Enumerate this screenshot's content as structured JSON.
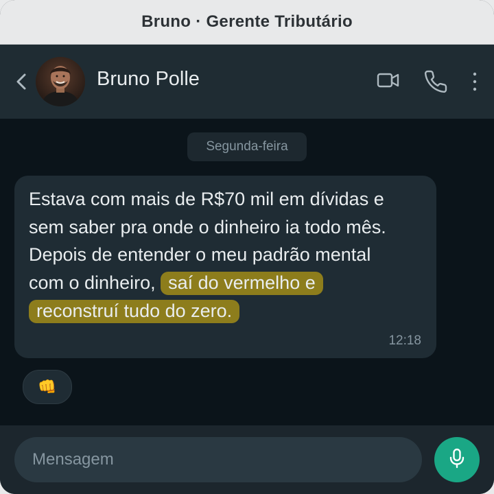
{
  "window": {
    "title": "Bruno · Gerente Tributário"
  },
  "header": {
    "contact_name": "Bruno Polle",
    "icons": [
      "back-chevron-icon",
      "video-camera-icon",
      "phone-icon",
      "more-vertical-icon"
    ]
  },
  "chat": {
    "day_label": "Segunda-feira",
    "message": {
      "lines": [
        "Estava com mais de R$70 mil em dívidas e",
        "sem saber pra onde o dinheiro ia todo mês.",
        "Depois de entender o meu padrão mental",
        "com o dinheiro, ",
        "saí do vermelho e",
        "reconstruí tudo do zero."
      ],
      "time": "12:18"
    },
    "reaction": "👊"
  },
  "composer": {
    "placeholder": "Mensagem",
    "mic_icon": "microphone-icon"
  },
  "colors": {
    "background": "#0b141a",
    "header": "#1f2c33",
    "bubble": "#1f2c34",
    "highlight": "#8d7d1c",
    "accent": "#1aa785"
  }
}
